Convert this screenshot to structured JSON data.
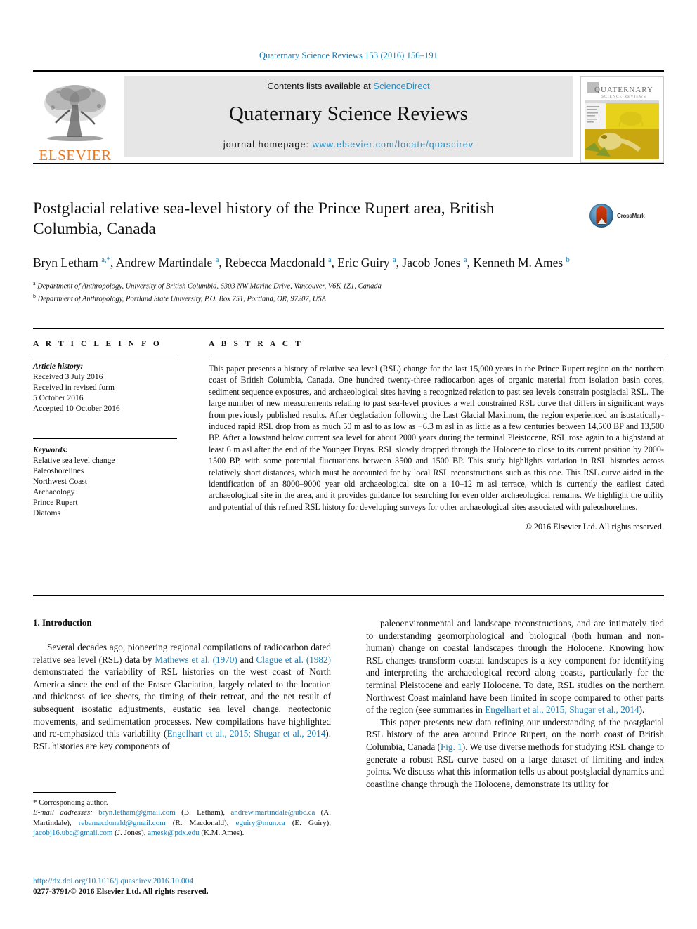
{
  "running_head": "Quaternary Science Reviews 153 (2016) 156–191",
  "masthead": {
    "contents_prefix": "Contents lists available at ",
    "sciencedirect": "ScienceDirect",
    "journal_name": "Quaternary Science Reviews",
    "homepage_prefix": "journal homepage: ",
    "homepage_url": "www.elsevier.com/locate/quascirev",
    "publisher": "ELSEVIER",
    "cover_title_line1": "QUATERNARY",
    "cover_title_line2": "SCIENCE REVIEWS"
  },
  "crossmark": {
    "label": "CrossMark"
  },
  "article": {
    "title": "Postglacial relative sea-level history of the Prince Rupert area, British Columbia, Canada",
    "authors_html": "Bryn Letham <sup class=\"sup\">a,</sup><sup class=\"sup-star\">*</sup>, Andrew Martindale <sup class=\"sup\">a</sup>, Rebecca Macdonald <sup class=\"sup\">a</sup>, Eric Guiry <sup class=\"sup\">a</sup>, Jacob Jones <sup class=\"sup\">a</sup>, Kenneth M. Ames <sup class=\"sup\">b</sup>",
    "affiliation_a": "Department of Anthropology, University of British Columbia, 6303 NW Marine Drive, Vancouver, V6K 1Z1, Canada",
    "affiliation_b": "Department of Anthropology, Portland State University, P.O. Box 751, Portland, OR, 97207, USA",
    "affiliation_a_marker": "a",
    "affiliation_b_marker": "b"
  },
  "article_info": {
    "heading": "A R T I C L E   I N F O",
    "history_label": "Article history:",
    "history_lines": [
      "Received 3 July 2016",
      "Received in revised form",
      "5 October 2016",
      "Accepted 10 October 2016"
    ],
    "keywords_label": "Keywords:",
    "keywords": [
      "Relative sea level change",
      "Paleoshorelines",
      "Northwest Coast",
      "Archaeology",
      "Prince Rupert",
      "Diatoms"
    ]
  },
  "abstract": {
    "heading": "A B S T R A C T",
    "text": "This paper presents a history of relative sea level (RSL) change for the last 15,000 years in the Prince Rupert region on the northern coast of British Columbia, Canada. One hundred twenty-three radiocarbon ages of organic material from isolation basin cores, sediment sequence exposures, and archaeological sites having a recognized relation to past sea levels constrain postglacial RSL. The large number of new measurements relating to past sea-level provides a well constrained RSL curve that differs in significant ways from previously published results. After deglaciation following the Last Glacial Maximum, the region experienced an isostatically-induced rapid RSL drop from as much 50 m asl to as low as −6.3 m asl in as little as a few centuries between 14,500 BP and 13,500 BP. After a lowstand below current sea level for about 2000 years during the terminal Pleistocene, RSL rose again to a highstand at least 6 m asl after the end of the Younger Dryas. RSL slowly dropped through the Holocene to close to its current position by 2000-1500 BP, with some potential fluctuations between 3500 and 1500 BP. This study highlights variation in RSL histories across relatively short distances, which must be accounted for by local RSL reconstructions such as this one. This RSL curve aided in the identification of an 8000–9000 year old archaeological site on a 10–12 m asl terrace, which is currently the earliest dated archaeological site in the area, and it provides guidance for searching for even older archaeological remains. We highlight the utility and potential of this refined RSL history for developing surveys for other archaeological sites associated with paleoshorelines.",
    "copyright": "© 2016 Elsevier Ltd. All rights reserved."
  },
  "body": {
    "section_heading": "1. Introduction",
    "left_paragraph_html": "Several decades ago, pioneering regional compilations of radiocarbon dated relative sea level (RSL) data by <span class=\"ref\">Mathews et al. (1970)</span> and <span class=\"ref\">Clague et al. (1982)</span> demonstrated the variability of RSL histories on the west coast of North America since the end of the Fraser Glaciation, largely related to the location and thickness of ice sheets, the timing of their retreat, and the net result of subsequent isostatic adjustments, eustatic sea level change, neotectonic movements, and sedimentation processes. New compilations have highlighted and re-emphasized this variability (<span class=\"ref\">Engelhart et al., 2015; Shugar et al., 2014</span>). RSL histories are key components of",
    "right_paragraph1_html": "paleoenvironmental and landscape reconstructions, and are intimately tied to understanding geomorphological and biological (both human and non-human) change on coastal landscapes through the Holocene. Knowing how RSL changes transform coastal landscapes is a key component for identifying and interpreting the archaeological record along coasts, particularly for the terminal Pleistocene and early Holocene. To date, RSL studies on the northern Northwest Coast mainland have been limited in scope compared to other parts of the region (see summaries in <span class=\"ref\">Engelhart et al., 2015; Shugar et al., 2014</span>).",
    "right_paragraph2_html": "This paper presents new data refining our understanding of the postglacial RSL history of the area around Prince Rupert, on the north coast of British Columbia, Canada (<span class=\"ref\">Fig. 1</span>). We use diverse methods for studying RSL change to generate a robust RSL curve based on a large dataset of limiting and index points. We discuss what this information tells us about postglacial dynamics and coastline change through the Holocene, demonstrate its utility for"
  },
  "footnote": {
    "corresponding": "* Corresponding author.",
    "email_label": "E-mail addresses:",
    "emails_html": " <span class=\"lnk\">bryn.letham@gmail.com</span> (B. Letham), <span class=\"lnk\">andrew.martindale@ubc.ca</span> (A. Martindale), <span class=\"lnk\">rebamacdonald@gmail.com</span> (R. Macdonald), <span class=\"lnk\">eguiry@mun.ca</span> (E. Guiry), <span class=\"lnk\">jacobj16.ubc@gmail.com</span> (J. Jones), <span class=\"lnk\">amesk@pdx.edu</span> (K.M. Ames).",
    "doi_url": "http://dx.doi.org/10.1016/j.quascirev.2016.10.004",
    "issn_line": "0277-3791/© 2016 Elsevier Ltd. All rights reserved."
  },
  "colors": {
    "link_blue": "#1a7db6",
    "elsevier_orange": "#E87722",
    "panel_gray": "#e6e6e6"
  }
}
